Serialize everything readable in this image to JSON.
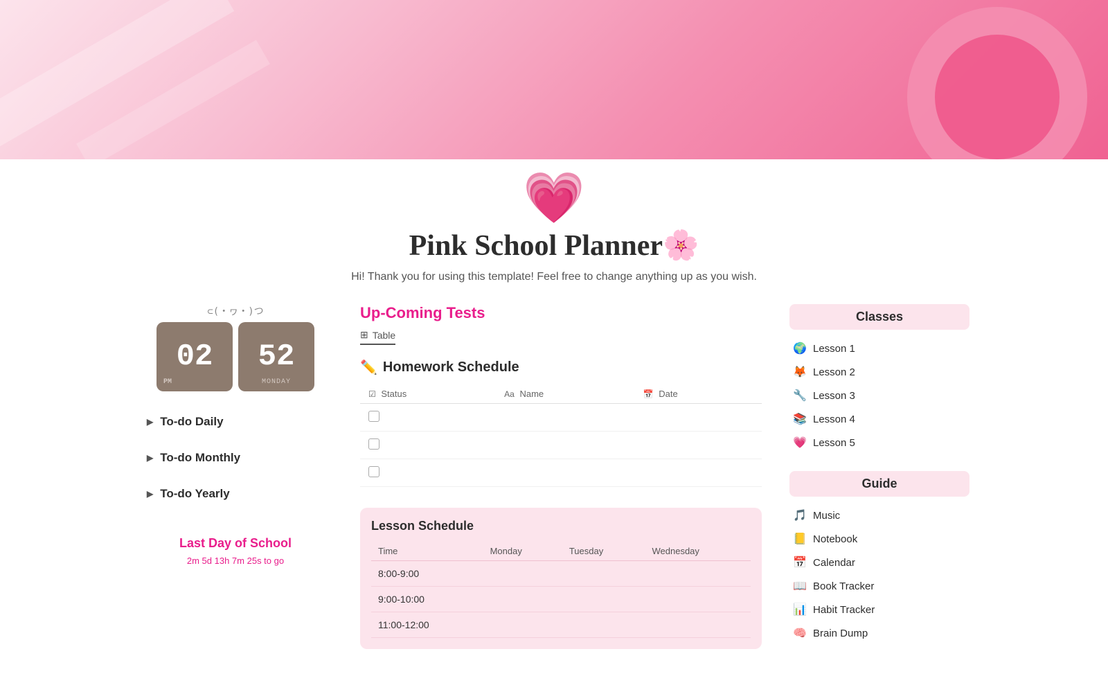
{
  "hero": {
    "alt": "Pink decorative banner"
  },
  "header": {
    "emoji": "💗",
    "title": "Pink School Planner🌸",
    "subtitle": "Hi! Thank you for using this template! Feel free to change anything up as you wish."
  },
  "clock": {
    "art": "⊂(・ヮ・)つ",
    "hours": "02",
    "minutes": "52",
    "pm_label": "PM",
    "day_label": "MONDAY"
  },
  "todo": {
    "items": [
      {
        "label": "To-do Daily"
      },
      {
        "label": "To-do Monthly"
      },
      {
        "label": "To-do Yearly"
      }
    ]
  },
  "last_day": {
    "title": "Last Day of School",
    "countdown": "2m 5d 13h 7m 25s to go"
  },
  "upcoming_tests": {
    "title": "Up-Coming Tests",
    "table_tab": "Table"
  },
  "homework": {
    "title": "Homework Schedule",
    "emoji": "✏️",
    "columns": [
      "Status",
      "Name",
      "Date"
    ],
    "rows": [
      {
        "status": "",
        "name": "",
        "date": ""
      },
      {
        "status": "",
        "name": "",
        "date": ""
      },
      {
        "status": "",
        "name": "",
        "date": ""
      }
    ]
  },
  "lesson_schedule": {
    "title": "Lesson Schedule",
    "columns": [
      "Time",
      "Monday",
      "Tuesday",
      "Wednesday"
    ],
    "rows": [
      {
        "time": "8:00-9:00",
        "monday": "",
        "tuesday": "",
        "wednesday": ""
      },
      {
        "time": "9:00-10:00",
        "monday": "",
        "tuesday": "",
        "wednesday": ""
      },
      {
        "time": "11:00-12:00",
        "monday": "",
        "tuesday": "",
        "wednesday": ""
      }
    ]
  },
  "classes": {
    "title": "Classes",
    "items": [
      {
        "emoji": "🌍",
        "label": "Lesson 1"
      },
      {
        "emoji": "🦊",
        "label": "Lesson 2"
      },
      {
        "emoji": "🔧",
        "label": "Lesson 3"
      },
      {
        "emoji": "📚",
        "label": "Lesson 4"
      },
      {
        "emoji": "💗",
        "label": "Lesson 5"
      }
    ]
  },
  "guide": {
    "title": "Guide",
    "items": [
      {
        "emoji": "🎵",
        "label": "Music"
      },
      {
        "emoji": "📒",
        "label": "Notebook"
      },
      {
        "emoji": "📅",
        "label": "Calendar"
      },
      {
        "emoji": "📖",
        "label": "Book Tracker"
      },
      {
        "emoji": "📊",
        "label": "Habit Tracker"
      },
      {
        "emoji": "🧠",
        "label": "Brain Dump"
      }
    ]
  }
}
